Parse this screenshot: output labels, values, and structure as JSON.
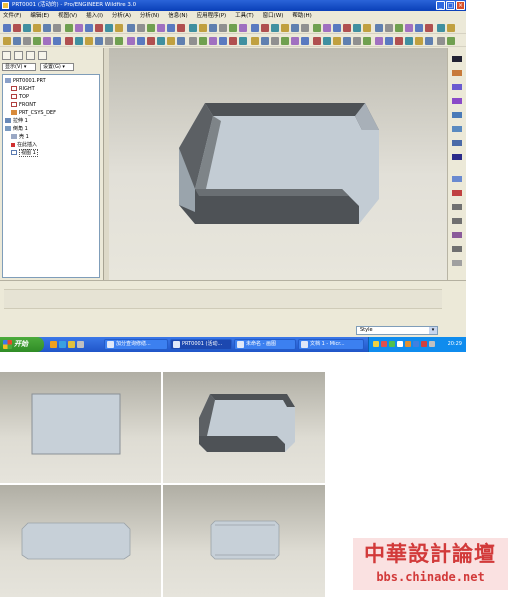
{
  "window": {
    "title": "PRT0001 (活动的) - Pro/ENGINEER Wildfire 3.0"
  },
  "menubar": [
    "文件(F)",
    "编辑(E)",
    "视图(V)",
    "插入(I)",
    "分析(A)",
    "分析(N)",
    "信息(N)",
    "应用程序(P)",
    "工具(T)",
    "窗口(W)",
    "帮助(H)"
  ],
  "sidepanel": {
    "dropdown_show": "显示(V) ▾",
    "dropdown_settings": "设置(G) ▾",
    "tree": [
      "PRT0001.PRT",
      "RIGHT",
      "TOP",
      "FRONT",
      "PRT_CSYS_DEF",
      "拉伸 1",
      "倒角 1",
      "壳 1",
      "在此插入",
      "视图 1"
    ]
  },
  "statusbar": {
    "filter_value": "Style"
  },
  "taskbar": {
    "start_label": "开始",
    "tasks": [
      "加分查询修缮...",
      "PRT0001 (活动...",
      "未命名 - 画图",
      "文档 1 - Micr..."
    ],
    "clock": "20:29"
  },
  "watermark": {
    "title": "中華設計論壇",
    "url": "bbs.chinade.net"
  },
  "colors": {
    "xp_blue": "#1f55c8",
    "model_face": "#c3ccd4",
    "model_dark": "#4e5256",
    "watermark_red": "#d23a3a"
  }
}
